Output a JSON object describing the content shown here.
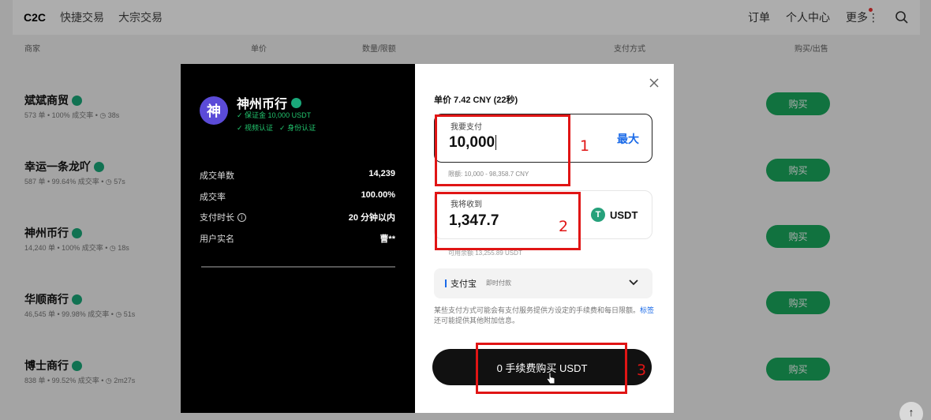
{
  "topnav": {
    "tabs": [
      "C2C",
      "快捷交易",
      "大宗交易"
    ],
    "right": [
      "订单",
      "个人中心",
      "更多"
    ]
  },
  "table_header": {
    "merchant": "商家",
    "price": "单价",
    "quantity": "数量/限额",
    "payment": "支付方式",
    "action": "购买/出售"
  },
  "merchants": [
    {
      "name": "斌斌商贸",
      "stats": "573 单 • 100% 成交率 • ◷ 38s",
      "action": "购买"
    },
    {
      "name": "幸运一条龙吖",
      "stats": "587 单 • 99.64% 成交率 • ◷ 57s",
      "action": "购买"
    },
    {
      "name": "神州币行",
      "stats": "14,240 单 • 100% 成交率 • ◷ 18s",
      "action": "购买"
    },
    {
      "name": "华顺商行",
      "stats": "46,545 单 • 99.98% 成交率 • ◷ 51s",
      "action": "购买"
    },
    {
      "name": "博士商行",
      "stats": "838 单 • 99.52% 成交率 • ◷ 2m27s",
      "action": "购买"
    }
  ],
  "modal": {
    "merchant": {
      "avatar_char": "神",
      "name": "神州币行",
      "deposit": "✓ 保证金 10,000 USDT",
      "video_verified": "✓ 视频认证",
      "id_verified": "✓ 身份认证"
    },
    "stats": [
      {
        "label": "成交单数",
        "value": "14,239"
      },
      {
        "label": "成交率",
        "value": "100.00%"
      },
      {
        "label": "支付时长",
        "value": "20 分钟以内"
      },
      {
        "label": "用户实名",
        "value": "曹**"
      }
    ],
    "price_line": "单价 7.42 CNY (22秒)",
    "pay": {
      "label": "我要支付",
      "amount": "10,000",
      "max": "最大",
      "limit": "限额: 10,000 - 98,358.7 CNY"
    },
    "receive": {
      "label": "我将收到",
      "amount": "1,347.7",
      "currency": "USDT",
      "available": "可用余额 13,255.89 USDT"
    },
    "payment_method": {
      "name": "支付宝",
      "sub": "即时付款"
    },
    "note": "某些支付方式可能会有支付服务提供方设定的手续费和每日限额。",
    "note_link": "标签",
    "note_tail": " 还可能提供其他附加信息。",
    "buy_button": "0 手续费购买 USDT"
  },
  "annotations": [
    "1",
    "2",
    "3"
  ],
  "colors": {
    "buy_green": "#1aa85e",
    "verified_green": "#22c56e",
    "link_blue": "#1a6ae8",
    "annotation_red": "#e01515",
    "tether_green": "#26a17b"
  }
}
